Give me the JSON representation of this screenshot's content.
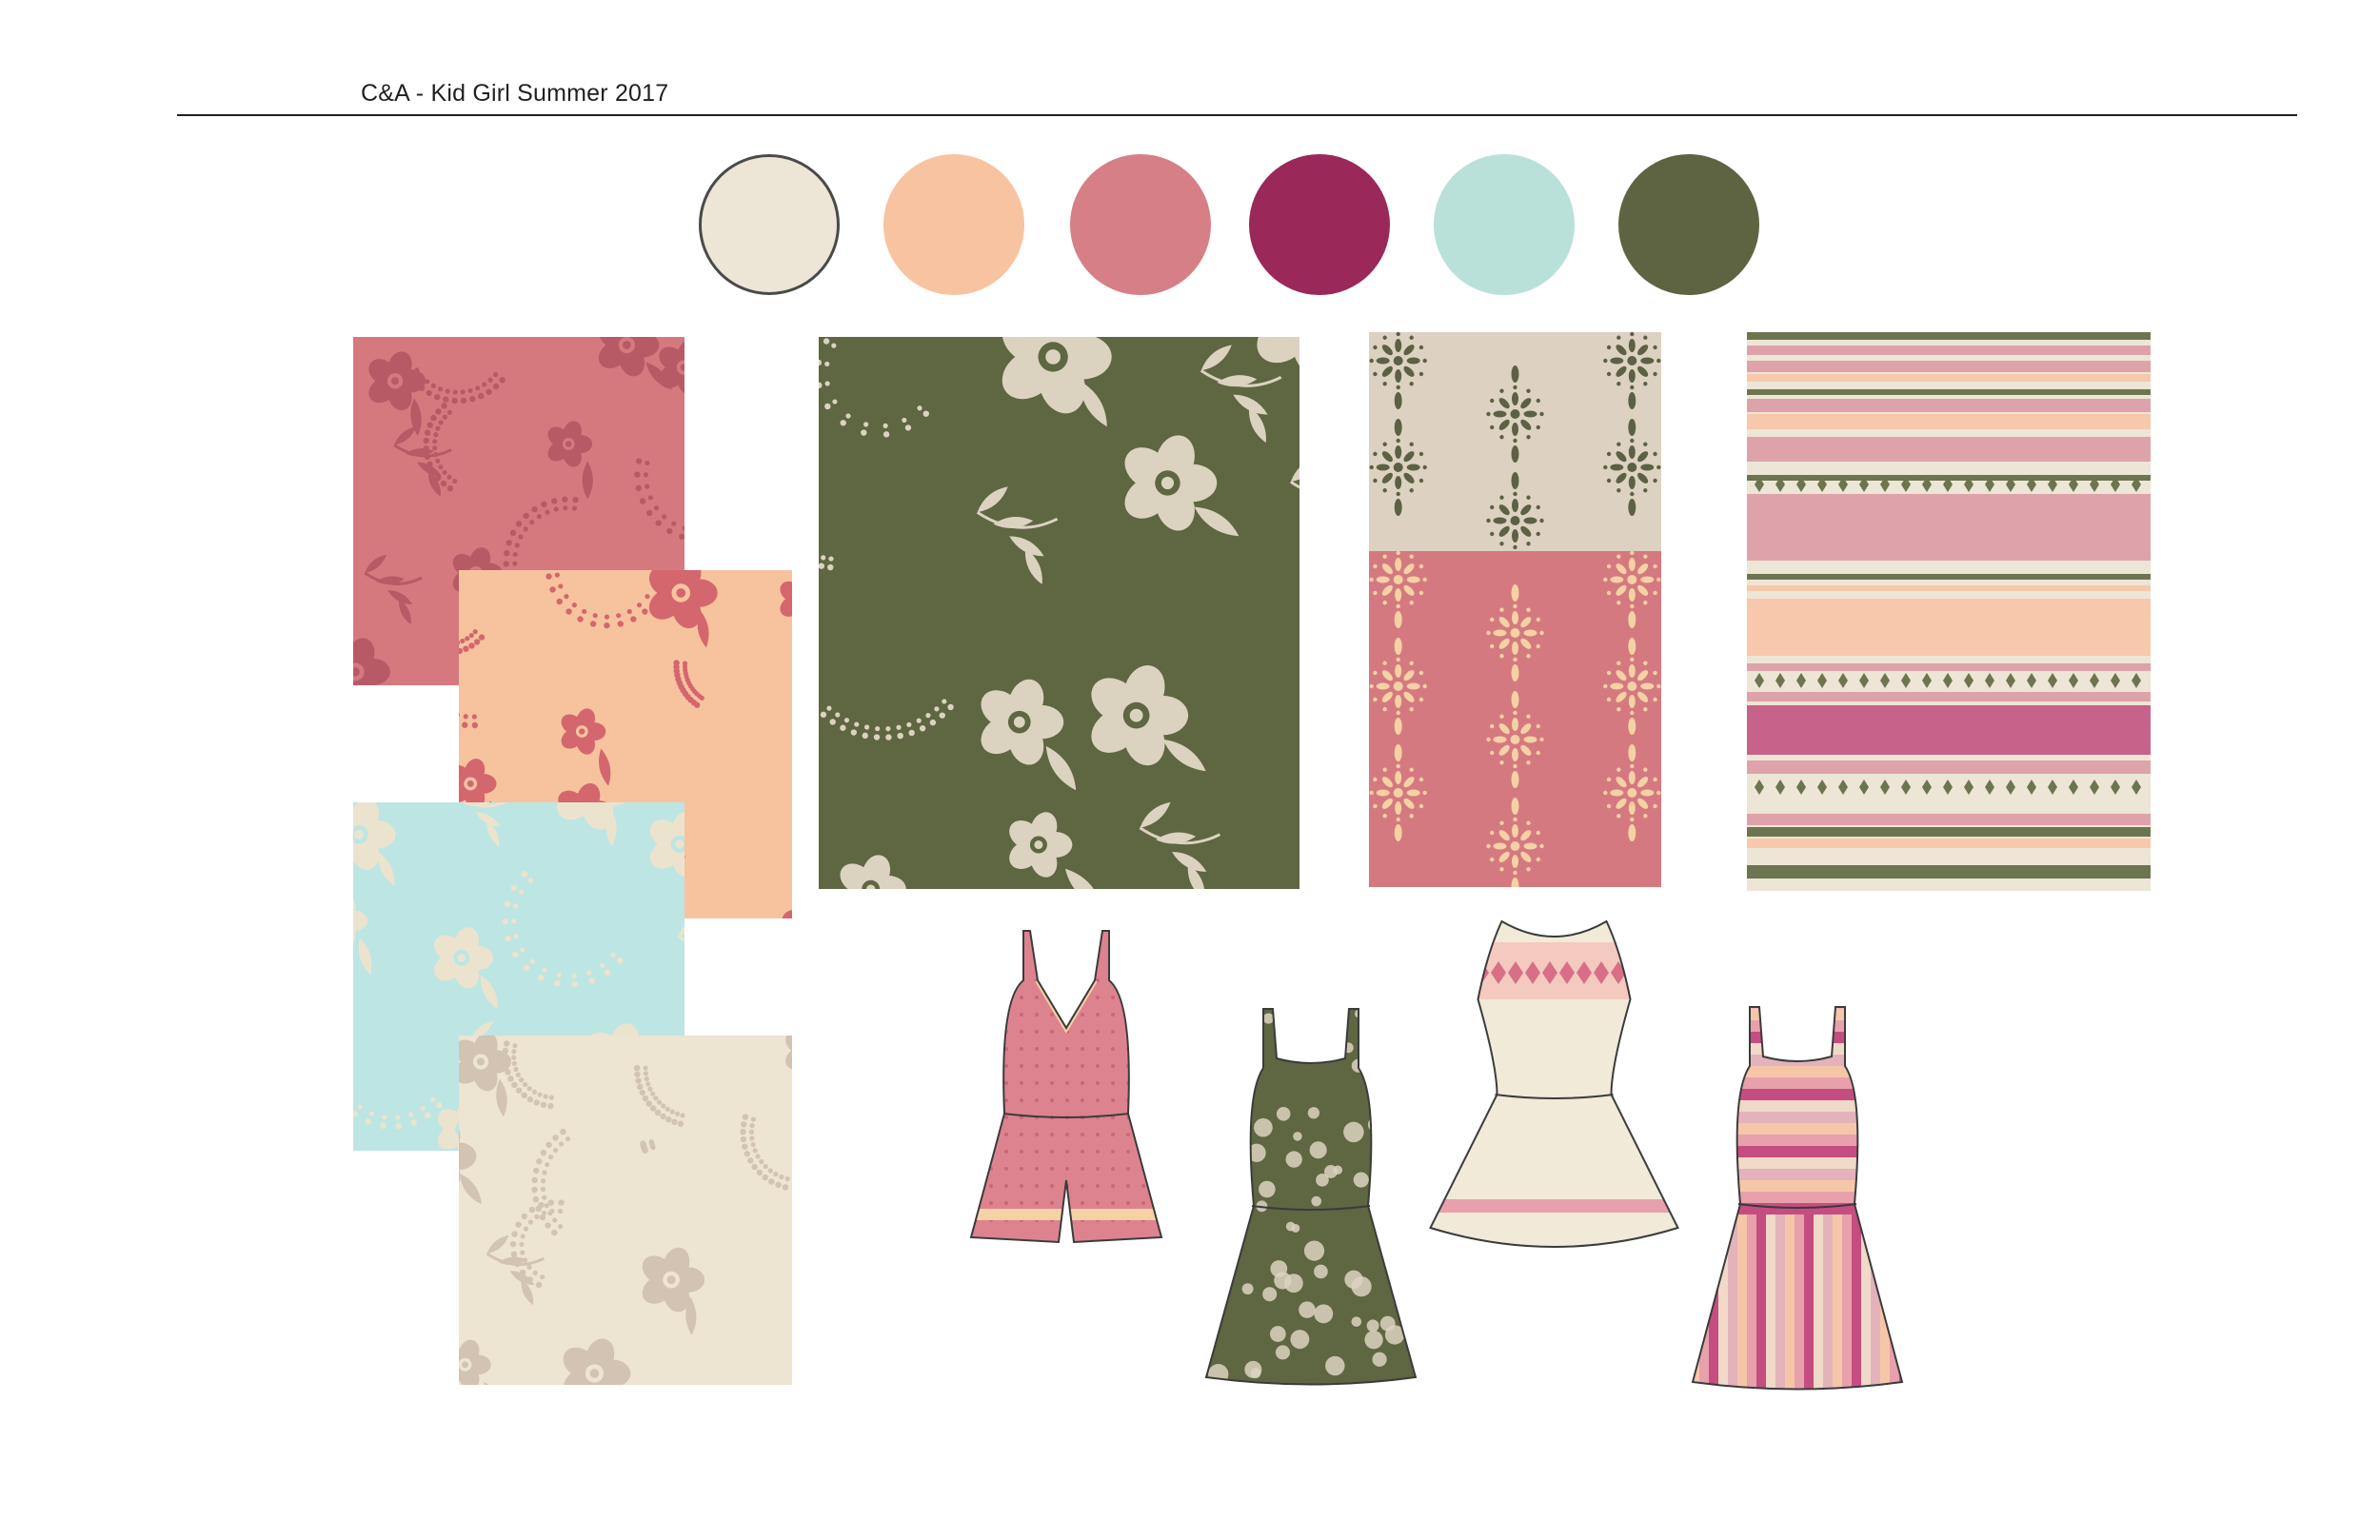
{
  "board": {
    "title": "C&A - Kid Girl Summer 2017"
  },
  "palette": [
    {
      "name": "cream-swatch",
      "color": "#ede5d5"
    },
    {
      "name": "peach-swatch",
      "color": "#f7c3a1"
    },
    {
      "name": "rose-swatch",
      "color": "#d67f86"
    },
    {
      "name": "berry-swatch",
      "color": "#9a2859"
    },
    {
      "name": "aqua-swatch",
      "color": "#bae0da"
    },
    {
      "name": "olive-swatch",
      "color": "#5e6442"
    }
  ],
  "prints": {
    "floral_rose": {
      "ground": "#d5797f",
      "motif": "#b85a66"
    },
    "floral_peach": {
      "ground": "#f7c39f",
      "motif": "#d4666e"
    },
    "floral_aqua": {
      "ground": "#bde5e3",
      "motif": "#ece3ce"
    },
    "floral_cream": {
      "ground": "#ede4d2",
      "motif": "#d2c3b3"
    },
    "floral_olive": {
      "ground": "#5e6642",
      "motif": "#dcd2c0"
    },
    "medallion_beige": {
      "ground": "#ddd2c1",
      "motif": "#5c6143"
    },
    "medallion_rose": {
      "ground": "#d57980",
      "motif": "#f5d1a6"
    },
    "stripe_colors": [
      "#ede5d5",
      "#dea2ab",
      "#f7c8ab",
      "#6d7550",
      "#c7628a"
    ]
  },
  "garments": [
    {
      "name": "romper-rose-sketch",
      "fabric": "#dd8390",
      "trim": "#f5d1a6"
    },
    {
      "name": "dress-olive-floral-sketch",
      "fabric": "#5e6642",
      "trim": "#dcd2c0"
    },
    {
      "name": "dress-cream-sketch",
      "fabric": "#f1ead9",
      "trim": "#d86f86"
    },
    {
      "name": "dress-stripe-sketch",
      "fabric": "#f2b4b6",
      "trim": "#c54d81"
    }
  ]
}
